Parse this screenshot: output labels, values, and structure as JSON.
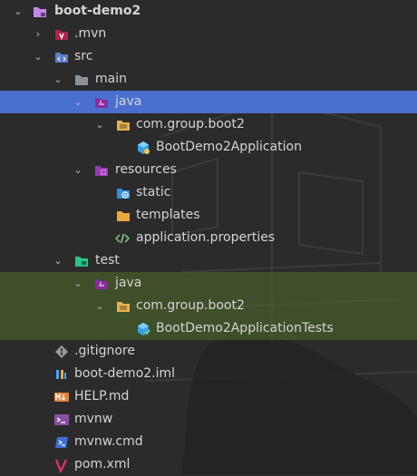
{
  "tree": [
    {
      "label": "boot-demo2",
      "expanded": true,
      "icon": "module-folder-icon"
    },
    {
      "label": ".mvn",
      "expanded": false,
      "icon": "folder-mvn-icon"
    },
    {
      "label": "src",
      "expanded": true,
      "icon": "folder-src-icon"
    },
    {
      "label": "main",
      "expanded": true,
      "icon": "folder-icon"
    },
    {
      "label": "java",
      "expanded": true,
      "icon": "source-folder-icon"
    },
    {
      "label": "com.group.boot2",
      "expanded": true,
      "icon": "package-icon"
    },
    {
      "label": "BootDemo2Application",
      "icon": "spring-class-icon"
    },
    {
      "label": "resources",
      "expanded": true,
      "icon": "resources-folder-icon"
    },
    {
      "label": "static",
      "icon": "web-folder-icon"
    },
    {
      "label": "templates",
      "icon": "folder-yellow-icon"
    },
    {
      "label": "application.properties",
      "icon": "properties-file-icon"
    },
    {
      "label": "test",
      "expanded": true,
      "icon": "test-folder-icon"
    },
    {
      "label": "java",
      "expanded": true,
      "icon": "test-source-folder-icon"
    },
    {
      "label": "com.group.boot2",
      "expanded": true,
      "icon": "package-icon"
    },
    {
      "label": "BootDemo2ApplicationTests",
      "icon": "spring-test-class-icon"
    },
    {
      "label": ".gitignore",
      "icon": "git-icon"
    },
    {
      "label": "boot-demo2.iml",
      "icon": "iml-file-icon"
    },
    {
      "label": "HELP.md",
      "icon": "markdown-icon"
    },
    {
      "label": "mvnw",
      "icon": "shell-icon"
    },
    {
      "label": "mvnw.cmd",
      "icon": "cmd-icon"
    },
    {
      "label": "pom.xml",
      "icon": "maven-icon"
    }
  ],
  "colors": {
    "selection": "#4a6fcf",
    "text": "#d4d4d4",
    "background": "#2b2b2b"
  }
}
